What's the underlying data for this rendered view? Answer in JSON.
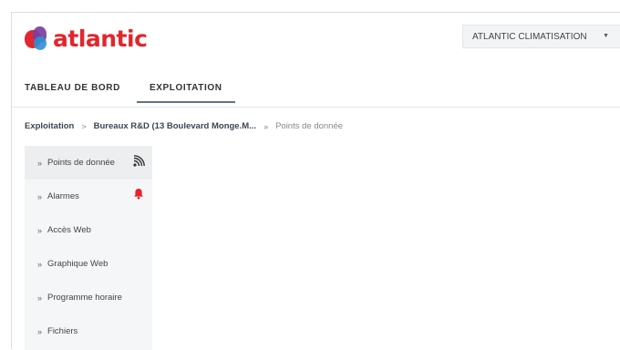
{
  "brand": {
    "logo_text": "atlantic",
    "colors": {
      "red": "#e1262d",
      "purple": "#7a3fa0",
      "blue": "#2d8fd6"
    }
  },
  "company_select": {
    "value": "ATLANTIC CLIMATISATION",
    "caret": "▼"
  },
  "tabs": [
    {
      "label": "TABLEAU DE BORD",
      "active": false
    },
    {
      "label": "EXPLOITATION",
      "active": true
    }
  ],
  "breadcrumb": {
    "items": [
      "Exploitation",
      "Bureaux R&D (13 Boulevard Monge.M...",
      "Points de donnée"
    ],
    "separators": [
      ">",
      "»"
    ]
  },
  "sidebar": {
    "chevron": "»",
    "items": [
      {
        "label": "Points de donnée",
        "icon": "rss-feed-icon",
        "active": true
      },
      {
        "label": "Alarmes",
        "icon": "bell-icon",
        "icon_color": "#e8212a"
      },
      {
        "label": "Accès Web"
      },
      {
        "label": "Graphique Web"
      },
      {
        "label": "Programme horaire"
      },
      {
        "label": "Fichiers"
      }
    ]
  }
}
